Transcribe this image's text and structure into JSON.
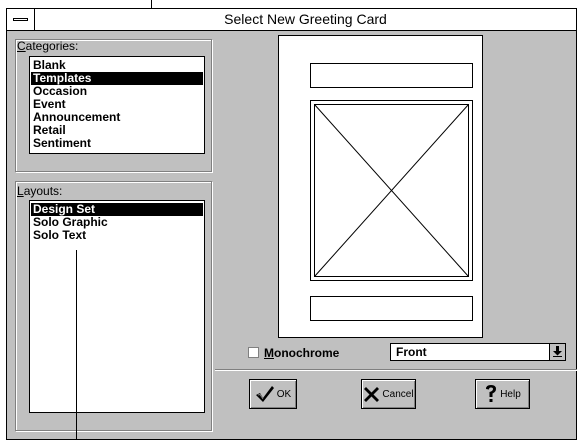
{
  "window": {
    "title": "Select New Greeting Card",
    "system_menu_icon": "system-menu-icon"
  },
  "categories": {
    "label_underline": "C",
    "label_rest": "ategories:",
    "items": [
      "Blank",
      "Templates",
      "Occasion",
      "Event",
      "Announcement",
      "Retail",
      "Sentiment"
    ],
    "selected": "Templates"
  },
  "layouts": {
    "label_underline": "L",
    "label_rest": "ayouts:",
    "items": [
      "Design Set",
      "Solo Graphic",
      "Solo Text"
    ],
    "selected": "Design Set"
  },
  "options": {
    "monochrome_underline": "M",
    "monochrome_rest": "onochrome",
    "monochrome_checked": false,
    "view_select_value": "Front"
  },
  "buttons": {
    "ok": {
      "label": "OK",
      "icon": "checkmark-icon"
    },
    "cancel": {
      "label": "Cancel",
      "icon": "x-cancel-icon"
    },
    "help": {
      "label": "Help",
      "icon": "question-mark-icon"
    }
  }
}
